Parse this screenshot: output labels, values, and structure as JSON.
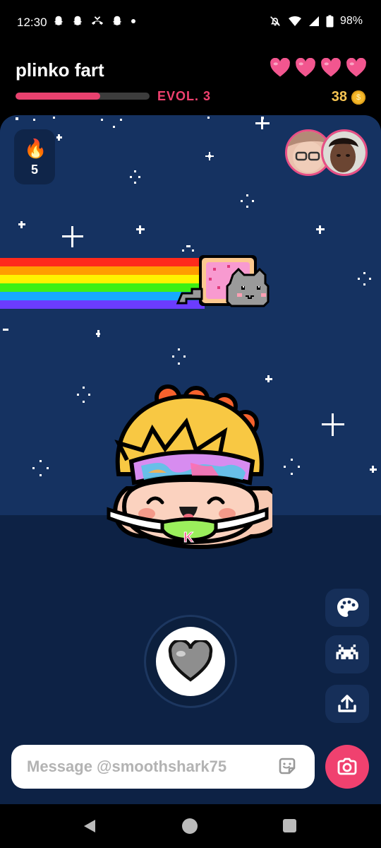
{
  "status_bar": {
    "time": "12:30",
    "notification_icons": [
      "snapchat-ghost-icon",
      "snapchat-ghost-icon",
      "missed-call-icon",
      "snapchat-ghost-icon",
      "dot-icon"
    ],
    "status_icons": [
      "do-not-disturb-icon",
      "wifi-icon",
      "cell-signal-icon",
      "battery-icon"
    ],
    "battery": "98%"
  },
  "header": {
    "chat_name": "plinko fart",
    "hearts_filled": 4,
    "hearts_total": 4,
    "evolution_progress": 0.63,
    "evolution_label": "EVOL. 3",
    "coins": "38",
    "coin_symbol": "$"
  },
  "scene": {
    "streak_icon": "fire-icon",
    "streak_count": "5",
    "friend_avatars": [
      "friend-avatar-1",
      "friend-avatar-2"
    ],
    "decoration": "nyan-cat-rainbow",
    "character": "bitmoji-pet-with-headband",
    "character_badge_letter": "K"
  },
  "actions": {
    "side_buttons": [
      "palette-icon",
      "space-invader-icon",
      "share-icon"
    ],
    "heart_button": "heart-icon"
  },
  "message_bar": {
    "placeholder": "Message @smoothshark75",
    "sticker_icon": "sticker-icon",
    "camera_icon": "camera-icon"
  },
  "nav_bar": {
    "buttons": [
      "back-icon",
      "home-icon",
      "recents-icon"
    ]
  },
  "colors": {
    "accent_pink": "#f0416f",
    "heart_pink": "#f2568f",
    "sky_blue": "#153261",
    "floor_navy": "#0d2245",
    "coin_gold": "#f7c552"
  }
}
